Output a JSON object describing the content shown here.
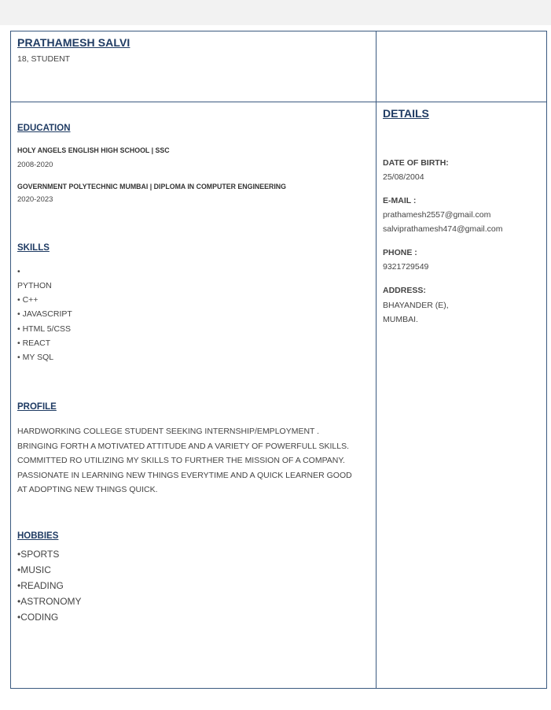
{
  "header": {
    "name": "PRATHAMESH SALVI",
    "subtitle": "18,  STUDENT"
  },
  "education": {
    "heading": "EDUCATION",
    "entries": [
      {
        "school": "HOLY ANGELS ENGLISH HIGH SCHOOL  |  SSC",
        "years": "2008-2020"
      },
      {
        "school": "GOVERNMENT POLYTECHNIC MUMBAI | DIPLOMA IN COMPUTER ENGINEERING",
        "years": "2020-2023"
      }
    ]
  },
  "skills": {
    "heading": "SKILLS",
    "items": [
      "•",
      "PYTHON",
      "• C++",
      "• JAVASCRIPT",
      "• HTML 5/CSS",
      "• REACT",
      "• MY SQL"
    ]
  },
  "profile": {
    "heading": "PROFILE",
    "lead": " ",
    "lines": [
      "HARDWORKING COLLEGE STUDENT SEEKING INTERNSHIP/EMPLOYMENT .",
      "BRINGING FORTH A MOTIVATED ATTITUDE AND A VARIETY OF POWERFULL SKILLS.",
      "COMMITTED RO UTILIZING MY SKILLS TO FURTHER THE MISSION OF A COMPANY.",
      "PASSIONATE IN LEARNING NEW THINGS EVERYTIME AND A QUICK LEARNER GOOD",
      "AT ADOPTING NEW THINGS QUICK."
    ]
  },
  "hobbies": {
    "heading": "HOBBIES",
    "items": [
      "•SPORTS",
      "•MUSIC",
      "•READING",
      "•ASTRONOMY",
      "•CODING"
    ]
  },
  "details": {
    "heading": "DETAILS",
    "dob_label": "DATE OF BIRTH:",
    "dob": "25/08/2004",
    "email_label": "E-MAIL :",
    "email_1": "prathamesh2557@gmail.com",
    "email_2": "salviprathamesh474@gmail.com",
    "phone_label": "PHONE :",
    "phone": "9321729549",
    "address_label": "ADDRESS:",
    "address_1": "BHAYANDER (E),",
    "address_2": "MUMBAI."
  }
}
